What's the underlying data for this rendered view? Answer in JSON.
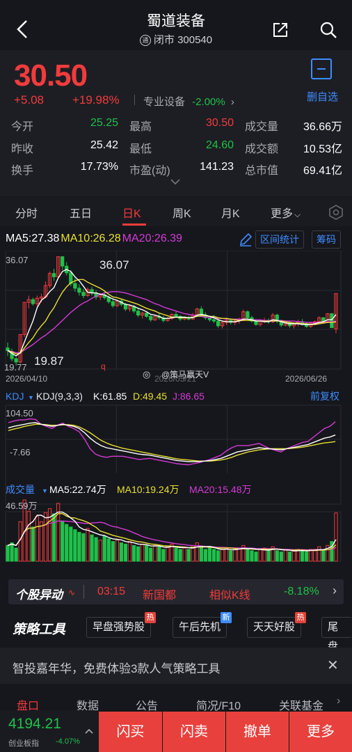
{
  "header": {
    "name": "蜀道装备",
    "market_icon": "通",
    "status": "闭市",
    "code": "300540"
  },
  "quote": {
    "price": "30.50",
    "change": "+5.08",
    "change_pct": "+19.98%",
    "sector": "专业设备",
    "sector_change": "-2.00%",
    "remove_label": "删自选",
    "stats": [
      {
        "label": "今开",
        "value": "25.25"
      },
      {
        "label": "最高",
        "value": "30.50"
      },
      {
        "label": "成交量",
        "value": "36.66万"
      },
      {
        "label": "昨收",
        "value": "25.42"
      },
      {
        "label": "最低",
        "value": "24.60"
      },
      {
        "label": "成交额",
        "value": "10.53亿"
      },
      {
        "label": "换手",
        "value": "17.73%"
      },
      {
        "label": "市盈(动)",
        "value": "141.23"
      },
      {
        "label": "总市值",
        "value": "69.41亿"
      }
    ]
  },
  "tabs": [
    "分时",
    "五日",
    "日K",
    "周K",
    "月K",
    "更多"
  ],
  "ma": {
    "ma5": "MA5:27.38",
    "ma10": "MA10:26.28",
    "ma20": "MA20:26.39",
    "interval_label": "区间统计",
    "chips_label": "筹码"
  },
  "kline": {
    "max_label": "36.07",
    "max_annot": "36.07",
    "min_label": "19.77",
    "min_annot": "19.87",
    "q_mark": "q",
    "date_start": "2026/04/10",
    "date_mid": "2026/05/21",
    "date_end": "2026/06/26",
    "watermark": "@策马赢天V"
  },
  "kdj": {
    "title": "KDJ",
    "params": "KDJ(9,3,3)",
    "k": "K:61.85",
    "d": "D:49.45",
    "j": "J:86.65",
    "fq": "前复权",
    "max": "104.50",
    "min": "-7.66"
  },
  "vol": {
    "title": "成交量",
    "ma5": "MA5:22.74万",
    "ma10": "MA10:19.24万",
    "ma20": "MA20:15.48万",
    "max": "46.59万"
  },
  "movement": {
    "brand": "个股异动",
    "time": "03:15",
    "event": "新国都",
    "similar": "相似K线",
    "pct": "-8.18%"
  },
  "strategy": {
    "brand": "策略工具",
    "chips": [
      {
        "label": "早盘强势股",
        "badge": "热"
      },
      {
        "label": "午后先机",
        "badge": "新"
      },
      {
        "label": "天天好股",
        "badge": "热"
      },
      {
        "label": "尾盘",
        "badge": ""
      }
    ]
  },
  "banner": {
    "text": "智投嘉年华，免费体验3款人气策略工具"
  },
  "bottom_tabs": [
    "盘口",
    "数据",
    "公告",
    "简况/F10",
    "关联基金"
  ],
  "index": {
    "value": "4194.21",
    "name": "创业板指",
    "change": "-4.07%"
  },
  "actions": [
    "闪买",
    "闪卖",
    "撤单",
    "更多"
  ],
  "colors": {
    "up": "#f23b3b",
    "down": "#1fc14a",
    "ma5": "#ffffff",
    "ma10": "#e8e030",
    "ma20": "#d53ad8",
    "accent": "#3e8cff"
  },
  "chart_data": {
    "type": "candlestick",
    "candles": [
      {
        "o": 22.4,
        "h": 23.2,
        "l": 21.2,
        "c": 22.0
      },
      {
        "o": 21.8,
        "h": 22.3,
        "l": 20.4,
        "c": 20.8
      },
      {
        "o": 20.8,
        "h": 21.0,
        "l": 19.77,
        "c": 20.3
      },
      {
        "o": 20.3,
        "h": 24.4,
        "l": 20.1,
        "c": 24.4
      },
      {
        "o": 24.4,
        "h": 29.2,
        "l": 24.0,
        "c": 29.2
      },
      {
        "o": 29.2,
        "h": 30.2,
        "l": 28.3,
        "c": 29.6
      },
      {
        "o": 29.6,
        "h": 29.9,
        "l": 28.7,
        "c": 29.0
      },
      {
        "o": 29.0,
        "h": 30.2,
        "l": 28.6,
        "c": 29.8
      },
      {
        "o": 29.8,
        "h": 30.5,
        "l": 29.2,
        "c": 30.0
      },
      {
        "o": 30.0,
        "h": 32.3,
        "l": 29.8,
        "c": 31.7
      },
      {
        "o": 31.7,
        "h": 33.8,
        "l": 31.3,
        "c": 33.5
      },
      {
        "o": 33.5,
        "h": 34.2,
        "l": 32.4,
        "c": 33.0
      },
      {
        "o": 33.0,
        "h": 36.07,
        "l": 32.9,
        "c": 36.0
      },
      {
        "o": 36.0,
        "h": 36.07,
        "l": 34.0,
        "c": 34.6
      },
      {
        "o": 34.6,
        "h": 35.2,
        "l": 33.2,
        "c": 33.6
      },
      {
        "o": 33.6,
        "h": 34.0,
        "l": 31.6,
        "c": 32.0
      },
      {
        "o": 32.0,
        "h": 32.8,
        "l": 30.8,
        "c": 31.3
      },
      {
        "o": 31.3,
        "h": 31.9,
        "l": 30.2,
        "c": 30.7
      },
      {
        "o": 30.7,
        "h": 31.2,
        "l": 29.8,
        "c": 30.2
      },
      {
        "o": 30.2,
        "h": 31.4,
        "l": 30.0,
        "c": 31.1
      },
      {
        "o": 31.1,
        "h": 31.5,
        "l": 30.2,
        "c": 30.6
      },
      {
        "o": 30.6,
        "h": 31.0,
        "l": 29.6,
        "c": 30.0
      },
      {
        "o": 30.0,
        "h": 30.6,
        "l": 29.5,
        "c": 30.3
      },
      {
        "o": 30.3,
        "h": 30.8,
        "l": 29.6,
        "c": 29.9
      },
      {
        "o": 29.9,
        "h": 30.2,
        "l": 29.0,
        "c": 29.3
      },
      {
        "o": 29.3,
        "h": 29.8,
        "l": 28.4,
        "c": 28.7
      },
      {
        "o": 28.7,
        "h": 29.6,
        "l": 28.5,
        "c": 29.4
      },
      {
        "o": 29.4,
        "h": 29.7,
        "l": 28.6,
        "c": 28.9
      },
      {
        "o": 28.9,
        "h": 29.1,
        "l": 27.9,
        "c": 28.2
      },
      {
        "o": 28.2,
        "h": 28.9,
        "l": 27.8,
        "c": 28.6
      },
      {
        "o": 28.6,
        "h": 28.8,
        "l": 27.6,
        "c": 27.9
      },
      {
        "o": 27.9,
        "h": 28.3,
        "l": 27.0,
        "c": 27.3
      },
      {
        "o": 27.3,
        "h": 27.8,
        "l": 26.8,
        "c": 27.6
      },
      {
        "o": 27.6,
        "h": 27.9,
        "l": 26.9,
        "c": 27.1
      },
      {
        "o": 27.1,
        "h": 27.4,
        "l": 26.3,
        "c": 26.6
      },
      {
        "o": 26.6,
        "h": 27.3,
        "l": 26.4,
        "c": 27.1
      },
      {
        "o": 27.1,
        "h": 27.5,
        "l": 26.6,
        "c": 26.9
      },
      {
        "o": 26.9,
        "h": 27.2,
        "l": 26.2,
        "c": 26.5
      },
      {
        "o": 26.5,
        "h": 27.0,
        "l": 26.3,
        "c": 26.8
      },
      {
        "o": 26.8,
        "h": 27.6,
        "l": 26.6,
        "c": 27.4
      },
      {
        "o": 27.4,
        "h": 27.8,
        "l": 26.9,
        "c": 27.1
      },
      {
        "o": 27.1,
        "h": 27.3,
        "l": 26.4,
        "c": 26.7
      },
      {
        "o": 26.7,
        "h": 27.1,
        "l": 26.5,
        "c": 26.9
      },
      {
        "o": 26.9,
        "h": 27.2,
        "l": 26.5,
        "c": 26.7
      },
      {
        "o": 26.7,
        "h": 27.6,
        "l": 26.6,
        "c": 27.3
      },
      {
        "o": 27.3,
        "h": 28.4,
        "l": 27.2,
        "c": 28.2
      },
      {
        "o": 28.2,
        "h": 28.6,
        "l": 27.0,
        "c": 27.3
      },
      {
        "o": 27.3,
        "h": 27.7,
        "l": 26.6,
        "c": 26.9
      },
      {
        "o": 26.9,
        "h": 27.2,
        "l": 26.3,
        "c": 26.6
      },
      {
        "o": 26.6,
        "h": 27.3,
        "l": 26.1,
        "c": 26.4
      },
      {
        "o": 26.4,
        "h": 26.6,
        "l": 25.4,
        "c": 25.7
      },
      {
        "o": 25.7,
        "h": 26.4,
        "l": 25.3,
        "c": 26.2
      },
      {
        "o": 26.2,
        "h": 26.9,
        "l": 25.8,
        "c": 26.5
      },
      {
        "o": 26.5,
        "h": 26.8,
        "l": 25.9,
        "c": 26.2
      },
      {
        "o": 26.2,
        "h": 26.7,
        "l": 25.8,
        "c": 26.4
      },
      {
        "o": 26.4,
        "h": 26.9,
        "l": 26.0,
        "c": 26.6
      },
      {
        "o": 26.6,
        "h": 28.1,
        "l": 26.4,
        "c": 27.8
      },
      {
        "o": 27.8,
        "h": 28.0,
        "l": 26.6,
        "c": 26.9
      },
      {
        "o": 26.9,
        "h": 27.2,
        "l": 26.2,
        "c": 26.4
      },
      {
        "o": 26.4,
        "h": 26.7,
        "l": 25.7,
        "c": 25.9
      },
      {
        "o": 25.9,
        "h": 26.6,
        "l": 25.6,
        "c": 26.4
      },
      {
        "o": 26.4,
        "h": 26.9,
        "l": 26.1,
        "c": 26.5
      },
      {
        "o": 26.5,
        "h": 26.8,
        "l": 26.0,
        "c": 26.3
      },
      {
        "o": 26.3,
        "h": 27.6,
        "l": 26.1,
        "c": 27.3
      },
      {
        "o": 27.3,
        "h": 27.5,
        "l": 26.1,
        "c": 26.4
      },
      {
        "o": 26.4,
        "h": 26.6,
        "l": 25.5,
        "c": 25.8
      },
      {
        "o": 25.8,
        "h": 26.5,
        "l": 25.6,
        "c": 26.2
      },
      {
        "o": 26.2,
        "h": 26.4,
        "l": 25.4,
        "c": 25.7
      },
      {
        "o": 25.7,
        "h": 26.2,
        "l": 25.3,
        "c": 26.0
      },
      {
        "o": 26.0,
        "h": 26.6,
        "l": 25.6,
        "c": 26.3
      },
      {
        "o": 26.3,
        "h": 26.7,
        "l": 25.8,
        "c": 26.0
      },
      {
        "o": 26.0,
        "h": 26.2,
        "l": 25.4,
        "c": 25.6
      },
      {
        "o": 25.6,
        "h": 26.3,
        "l": 25.4,
        "c": 26.1
      },
      {
        "o": 26.1,
        "h": 26.5,
        "l": 25.8,
        "c": 26.3
      },
      {
        "o": 26.3,
        "h": 27.1,
        "l": 26.0,
        "c": 26.9
      },
      {
        "o": 26.9,
        "h": 27.0,
        "l": 26.0,
        "c": 26.2
      },
      {
        "o": 26.2,
        "h": 27.6,
        "l": 26.1,
        "c": 27.5
      },
      {
        "o": 27.5,
        "h": 27.6,
        "l": 25.4,
        "c": 25.42
      },
      {
        "o": 25.25,
        "h": 30.5,
        "l": 24.6,
        "c": 30.5
      }
    ],
    "ylim": [
      19.77,
      36.07
    ],
    "volume": [
      12,
      14,
      10,
      30,
      46.59,
      38,
      26,
      34,
      30,
      37,
      40,
      36,
      44,
      30,
      28,
      26,
      24,
      22,
      21,
      25,
      20,
      18,
      16,
      19,
      17,
      15,
      16,
      14,
      13,
      15,
      12,
      11,
      13,
      12,
      10,
      12,
      11,
      9,
      11,
      13,
      10,
      9,
      10,
      9,
      12,
      14,
      11,
      9,
      10,
      9,
      8,
      9,
      10,
      8,
      9,
      10,
      12,
      9,
      8,
      7,
      9,
      10,
      8,
      11,
      8,
      7,
      9,
      7,
      8,
      9,
      8,
      7,
      9,
      9,
      11,
      8,
      12,
      15,
      36.66
    ],
    "ma_lines": {
      "MA5": [
        22.0,
        21.6,
        21.2,
        21.7,
        23.3,
        24.9,
        26.4,
        28.4,
        29.5,
        30.0,
        30.8,
        31.4,
        32.8,
        33.8,
        34.1,
        33.8,
        33.0,
        32.4,
        31.6,
        30.7,
        30.6,
        30.6,
        30.4,
        30.3,
        30.0,
        29.7,
        29.5,
        29.2,
        28.9,
        28.8,
        28.6,
        28.3,
        28.1,
        27.8,
        27.4,
        27.3,
        27.1,
        26.8,
        26.8,
        26.9,
        27.0,
        27.0,
        27.0,
        26.9,
        26.9,
        27.3,
        27.4,
        27.3,
        27.1,
        26.9,
        26.6,
        26.4,
        26.3,
        26.3,
        26.3,
        26.4,
        26.7,
        26.7,
        26.6,
        26.4,
        26.4,
        26.3,
        26.3,
        26.6,
        26.5,
        26.3,
        26.1,
        26.0,
        26.0,
        26.0,
        25.9,
        25.9,
        25.9,
        26.0,
        26.2,
        26.3,
        26.6,
        26.6,
        27.38
      ],
      "MA10": [
        22.0,
        21.8,
        21.5,
        21.6,
        22.4,
        23.2,
        23.9,
        24.9,
        25.7,
        26.4,
        27.5,
        28.4,
        29.6,
        30.7,
        31.5,
        32.1,
        32.4,
        32.6,
        32.6,
        32.2,
        31.9,
        31.6,
        31.3,
        30.9,
        30.4,
        30.0,
        29.9,
        29.7,
        29.5,
        29.3,
        29.1,
        28.9,
        28.6,
        28.3,
        28.1,
        27.9,
        27.6,
        27.4,
        27.2,
        27.0,
        27.0,
        26.9,
        26.9,
        26.9,
        27.0,
        27.1,
        27.2,
        27.2,
        27.1,
        27.1,
        26.9,
        26.8,
        26.8,
        26.7,
        26.6,
        26.5,
        26.5,
        26.5,
        26.5,
        26.4,
        26.4,
        26.4,
        26.4,
        26.4,
        26.4,
        26.4,
        26.3,
        26.2,
        26.1,
        26.1,
        26.0,
        26.0,
        25.9,
        25.9,
        26.0,
        26.1,
        26.2,
        26.2,
        26.28
      ],
      "MA20": [
        22.0,
        21.9,
        21.7,
        21.7,
        22.1,
        22.5,
        22.9,
        23.4,
        23.9,
        24.3,
        24.8,
        25.3,
        25.9,
        26.5,
        27.1,
        27.7,
        28.2,
        28.7,
        29.1,
        29.4,
        29.8,
        30.1,
        30.4,
        30.6,
        30.7,
        30.8,
        30.8,
        30.7,
        30.6,
        30.4,
        30.2,
        30.0,
        29.8,
        29.6,
        29.3,
        29.0,
        28.8,
        28.5,
        28.3,
        28.1,
        27.9,
        27.7,
        27.5,
        27.4,
        27.3,
        27.2,
        27.1,
        27.0,
        26.9,
        26.9,
        26.8,
        26.8,
        26.7,
        26.7,
        26.7,
        26.7,
        26.7,
        26.7,
        26.6,
        26.6,
        26.6,
        26.5,
        26.5,
        26.5,
        26.5,
        26.5,
        26.4,
        26.4,
        26.4,
        26.3,
        26.3,
        26.2,
        26.2,
        26.2,
        26.2,
        26.2,
        26.3,
        26.3,
        26.39
      ]
    },
    "kdj_lines": {
      "K": [
        75,
        78,
        80,
        82,
        84,
        85,
        82,
        80,
        78,
        80,
        82,
        80,
        78,
        74,
        66,
        56,
        48,
        42,
        38,
        36,
        34,
        32,
        30,
        28,
        26,
        25,
        24,
        22,
        20,
        18,
        16,
        14,
        13,
        12,
        12,
        12,
        13,
        14,
        16,
        18,
        22,
        26,
        30,
        32,
        34,
        36,
        38,
        37,
        36,
        35,
        34,
        36,
        38,
        40,
        42,
        44,
        48,
        52,
        56,
        58,
        61.85
      ],
      "D": [
        70,
        73,
        75,
        78,
        80,
        82,
        82,
        81,
        80,
        80,
        81,
        81,
        80,
        77,
        72,
        66,
        59,
        52,
        47,
        43,
        40,
        37,
        35,
        33,
        31,
        29,
        27,
        25,
        23,
        21,
        19,
        17,
        16,
        15,
        14,
        13,
        13,
        13,
        14,
        15,
        17,
        20,
        24,
        27,
        30,
        32,
        34,
        35,
        36,
        36,
        36,
        36,
        37,
        38,
        39,
        41,
        43,
        45,
        47,
        48,
        49.45
      ],
      "J": [
        85,
        88,
        90,
        90,
        92,
        91,
        82,
        78,
        74,
        80,
        84,
        78,
        74,
        68,
        54,
        36,
        26,
        22,
        20,
        22,
        22,
        22,
        20,
        18,
        16,
        17,
        18,
        16,
        14,
        12,
        10,
        8,
        7,
        6,
        8,
        10,
        13,
        16,
        20,
        24,
        32,
        38,
        42,
        42,
        42,
        44,
        46,
        41,
        36,
        33,
        30,
        36,
        40,
        44,
        48,
        50,
        58,
        66,
        74,
        78,
        86.65
      ]
    },
    "kdj_ylim": [
      -7.66,
      104.5
    ],
    "vol_ylim": [
      0,
      46.59
    ]
  }
}
